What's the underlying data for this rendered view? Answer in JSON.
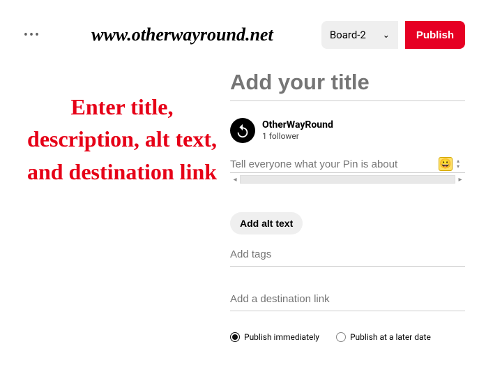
{
  "topbar": {
    "site_url": "www.otherwayround.net",
    "board_selected": "Board-2",
    "publish_label": "Publish"
  },
  "annotation": "Enter title, description, alt text, and destination link",
  "form": {
    "title_placeholder": "Add your title",
    "author_name": "OtherWayRound",
    "follower_count": "1 follower",
    "desc_placeholder": "Tell everyone what your Pin is about",
    "alt_text_label": "Add alt text",
    "tags_placeholder": "Add tags",
    "destination_placeholder": "Add a destination link"
  },
  "radios": {
    "immediate": "Publish immediately",
    "later": "Publish at a later date"
  }
}
